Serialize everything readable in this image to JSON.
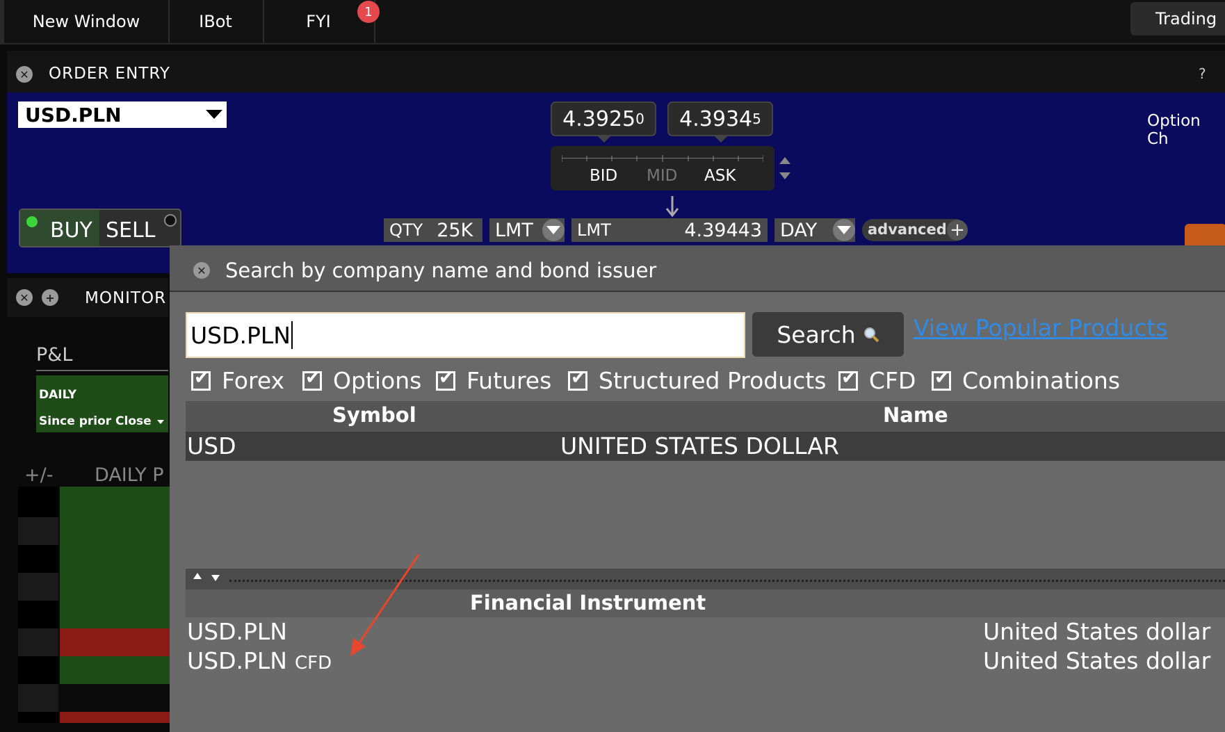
{
  "topbar": {
    "new_window": "New Window",
    "ibot": "IBot",
    "fyi": "FYI",
    "fyi_badge": "1",
    "trading": "Trading"
  },
  "order_entry": {
    "title": "ORDER ENTRY",
    "help": "?",
    "symbol": "USD.PLN",
    "option_chain": "Option Ch",
    "bid_price_main": "4.3925",
    "bid_price_sup": "0",
    "ask_price_main": "4.3934",
    "ask_price_sup": "5",
    "bid_label": "BID",
    "mid_label": "MID",
    "ask_label": "ASK",
    "buy_label": "BUY",
    "sell_label": "SELL",
    "qty_label": "QTY",
    "qty_value": "25K",
    "order_type": "LMT",
    "limit_label": "LMT",
    "limit_price": "4.39443",
    "tif": "DAY",
    "advanced_label": "advanced"
  },
  "monitor": {
    "title": "MONITOR",
    "pl_tab": "P&L",
    "daily_label": "DAILY",
    "since_label": "Since prior Close",
    "col_change": "+/-",
    "col_daily": "DAILY P"
  },
  "search_dialog": {
    "title": "Search by company name and bond issuer",
    "query": "USD.PLN",
    "search_button": "Search",
    "popular_link": "View Popular Products",
    "filters": [
      {
        "label": "Forex",
        "checked": true
      },
      {
        "label": "Options",
        "checked": true
      },
      {
        "label": "Futures",
        "checked": true
      },
      {
        "label": "Structured Products",
        "checked": true
      },
      {
        "label": "CFD",
        "checked": true
      },
      {
        "label": "Combinations",
        "checked": true
      }
    ],
    "table": {
      "col_symbol": "Symbol",
      "col_name": "Name",
      "rows": [
        {
          "symbol": "USD",
          "name": "UNITED STATES DOLLAR"
        }
      ]
    },
    "instruments": {
      "header": "Financial Instrument",
      "rows": [
        {
          "symbol": "USD.PLN",
          "suffix": "",
          "name": "United States dollar"
        },
        {
          "symbol": "USD.PLN",
          "suffix": "CFD",
          "name": "United States dollar"
        }
      ]
    }
  },
  "colors": {
    "order_entry_bg": "#0a0a5e",
    "link": "#2f8be6",
    "annotation_arrow": "#e8472e",
    "pl_green": "#1e4d18",
    "pl_red": "#8a1a14"
  }
}
